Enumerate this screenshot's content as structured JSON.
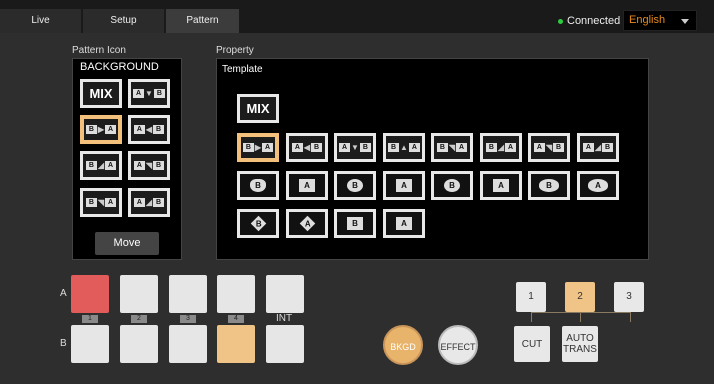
{
  "tabs": [
    {
      "label": "Live",
      "active": false
    },
    {
      "label": "Setup",
      "active": false
    },
    {
      "label": "Pattern",
      "active": true
    }
  ],
  "status": {
    "text": "Connected",
    "color": "#2ecc40"
  },
  "language": {
    "selected": "English"
  },
  "pattern_icon": {
    "label": "Pattern Icon",
    "title": "BACKGROUND",
    "move_label": "Move"
  },
  "property": {
    "label": "Property",
    "template_label": "Template"
  },
  "mix_label": "MIX",
  "crosspoint": {
    "row_a_label": "A",
    "row_b_label": "B",
    "num_tags": [
      "1",
      "2",
      "3",
      "4"
    ],
    "int_label": "INT"
  },
  "transition": {
    "bkgd_label": "BKGD",
    "effect_label": "EFFECT",
    "select": [
      "1",
      "2",
      "3"
    ],
    "cut_label": "CUT",
    "auto_trans_label": "AUTO\nTRANS"
  },
  "colors": {
    "accent": "#efc486",
    "selected_a": "#e25c5c",
    "language": "#e98a1f"
  }
}
